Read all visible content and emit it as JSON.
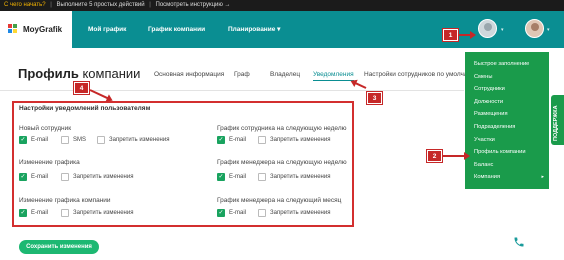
{
  "topbar": {
    "question": "С чего начать?",
    "tasks": "Выполните 5 простых действий",
    "instruction": "Посмотреть инструкцию",
    "arrow": "→"
  },
  "logo": {
    "text": "MoyGrafik"
  },
  "nav": {
    "my_schedule": "Мой график",
    "company_schedule": "График компании",
    "planning": "Планирование",
    "planning_caret": "▾"
  },
  "user_caret": "▾",
  "page": {
    "title_bold": "Профиль",
    "title_rest": " компании"
  },
  "tabs": [
    "Основная информация",
    "Граф",
    "Владелец",
    "Уведомления",
    "Настройки сотрудников по умолчан"
  ],
  "settings": {
    "title": "Настройки уведомлений пользователям",
    "left_groups": [
      {
        "title": "Новый сотрудник",
        "options": [
          {
            "label": "E-mail",
            "checked": true
          },
          {
            "label": "SMS",
            "checked": false
          },
          {
            "label": "Запретить изменения",
            "checked": false
          }
        ]
      },
      {
        "title": "Изменение графика",
        "options": [
          {
            "label": "E-mail",
            "checked": true
          },
          {
            "label": "Запретить изменения",
            "checked": false
          }
        ]
      },
      {
        "title": "Изменение графика компании",
        "options": [
          {
            "label": "E-mail",
            "checked": true
          },
          {
            "label": "Запретить изменения",
            "checked": false
          }
        ]
      }
    ],
    "right_groups": [
      {
        "title": "График сотрудника на следующую неделю",
        "options": [
          {
            "label": "E-mail",
            "checked": true
          },
          {
            "label": "Запретить изменения",
            "checked": false
          }
        ]
      },
      {
        "title": "График менеджера на следующую неделю",
        "options": [
          {
            "label": "E-mail",
            "checked": true
          },
          {
            "label": "Запретить изменения",
            "checked": false
          }
        ]
      },
      {
        "title": "График менеджера на следующий месяц",
        "options": [
          {
            "label": "E-mail",
            "checked": true
          },
          {
            "label": "Запретить изменения",
            "checked": false
          }
        ]
      }
    ]
  },
  "save_button": "Сохранить изменения",
  "user_menu": {
    "items": [
      "Быстрое заполнение",
      "Смены",
      "Сотрудники",
      "Должности",
      "Размещения",
      "Подразделения",
      "Участки",
      "Профиль компании",
      "Баланс",
      "Компания"
    ],
    "company_caret": "▸"
  },
  "side_tab": "ПОДДЕРЖКА",
  "annotations": [
    "1",
    "2",
    "3",
    "4"
  ],
  "colors": {
    "teal": "#0a8e92",
    "green": "#1a9b4b",
    "highlight_red": "#d32f2f"
  }
}
